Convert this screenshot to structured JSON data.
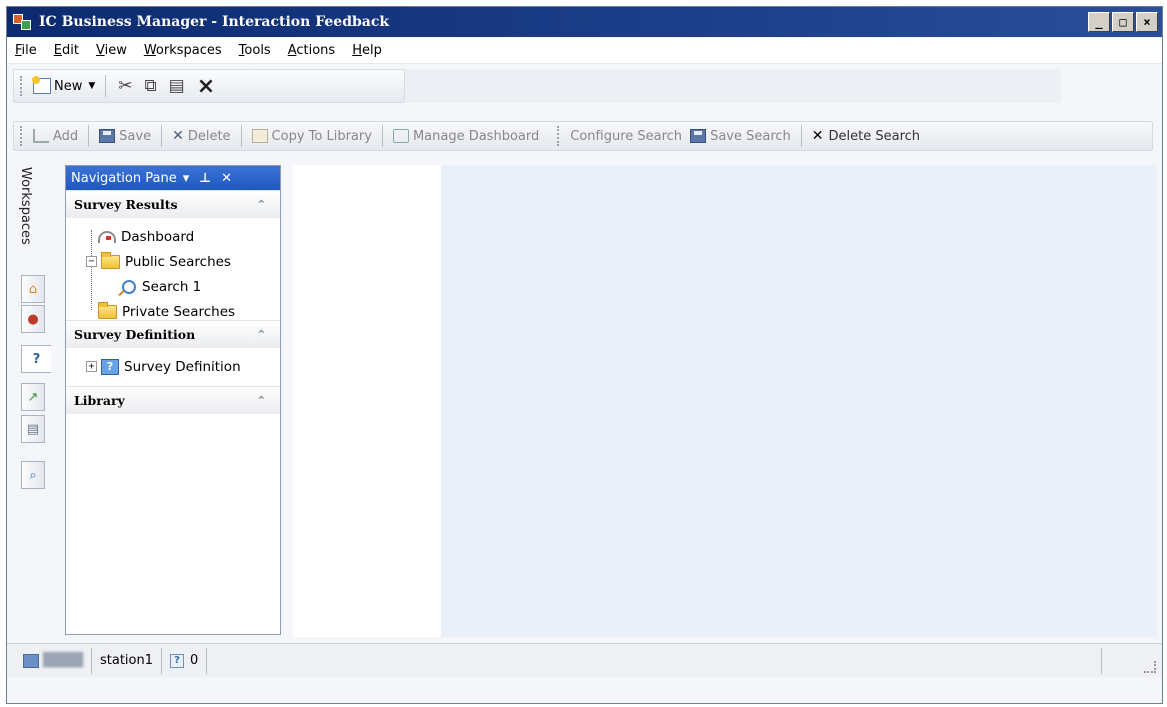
{
  "window": {
    "title": "IC Business Manager - Interaction Feedback",
    "controls": {
      "minimize": "_",
      "restore": "□",
      "close": "×"
    }
  },
  "menu": [
    "File",
    "Edit",
    "View",
    "Workspaces",
    "Tools",
    "Actions",
    "Help"
  ],
  "toolbar1": {
    "new_label": "New",
    "icons": [
      "new-icon",
      "cut-icon",
      "copy-icon",
      "paste-icon",
      "delete-icon"
    ]
  },
  "toolbar2": {
    "add": "Add",
    "save": "Save",
    "delete": "Delete",
    "copy_to_library": "Copy To Library",
    "manage_dashboard": "Manage Dashboard",
    "configure_search": "Configure Search",
    "save_search": "Save Search",
    "delete_search": "Delete Search"
  },
  "workspaces": {
    "label": "Workspaces",
    "tabs": [
      "home-icon",
      "people-icon",
      "survey-icon",
      "chart-icon",
      "report-icon",
      "search-doc-icon"
    ]
  },
  "nav_pane": {
    "title": "Navigation Pane",
    "sections": {
      "survey_results": "Survey Results",
      "survey_definition": "Survey Definition",
      "library": "Library"
    },
    "tree": {
      "dashboard": "Dashboard",
      "public_searches": "Public Searches",
      "search1": "Search 1",
      "private_searches": "Private Searches",
      "survey_definition_item": "Survey Definition"
    }
  },
  "statusbar": {
    "station": "station1",
    "count": "0"
  },
  "colors": {
    "titlebar": "#0b2a6f",
    "nav_header": "#1e57c0",
    "content_bg": "#eaf0f9"
  }
}
